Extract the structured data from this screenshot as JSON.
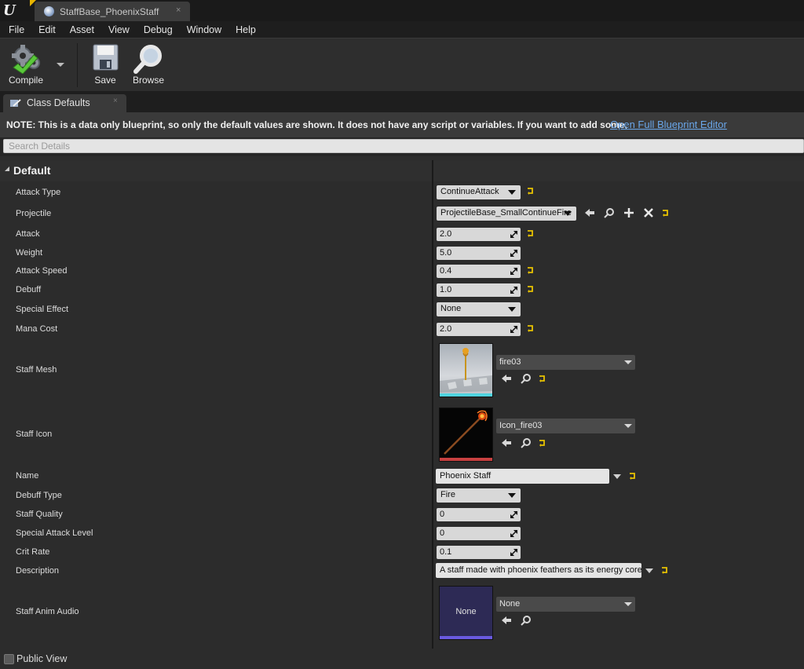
{
  "window": {
    "logo": "U",
    "doc_tab_title": "StaffBase_PhoenixStaff",
    "doc_tab_close": "×"
  },
  "menu": [
    "File",
    "Edit",
    "Asset",
    "View",
    "Debug",
    "Window",
    "Help"
  ],
  "toolbar": {
    "compile_label": "Compile",
    "save_label": "Save",
    "browse_label": "Browse"
  },
  "panel": {
    "tab_label": "Class Defaults",
    "tab_close": "×",
    "note": "NOTE: This is a data only blueprint, so only the default values are shown.  It does not have any script or variables.  If you want to add some,",
    "note_link": "Open Full Blueprint Editor",
    "search_placeholder": "Search Details",
    "category": "Default"
  },
  "properties": {
    "attack_type": {
      "label": "Attack Type",
      "value": "ContinueAttack"
    },
    "projectile": {
      "label": "Projectile",
      "value": "ProjectileBase_SmallContinueFire"
    },
    "attack": {
      "label": "Attack",
      "value": "2.0"
    },
    "weight": {
      "label": "Weight",
      "value": "5.0"
    },
    "attack_speed": {
      "label": "Attack Speed",
      "value": "0.4"
    },
    "debuff": {
      "label": "Debuff",
      "value": "1.0"
    },
    "special_effect": {
      "label": "Special Effect",
      "value": "None"
    },
    "mana_cost": {
      "label": "Mana Cost",
      "value": "2.0"
    },
    "staff_mesh": {
      "label": "Staff Mesh",
      "value": "fire03"
    },
    "staff_icon": {
      "label": "Staff Icon",
      "value": "Icon_fire03"
    },
    "name": {
      "label": "Name",
      "value": "Phoenix Staff"
    },
    "debuff_type": {
      "label": "Debuff Type",
      "value": "Fire"
    },
    "staff_quality": {
      "label": "Staff Quality",
      "value": "0"
    },
    "special_attack_level": {
      "label": "Special Attack Level",
      "value": "0"
    },
    "crit_rate": {
      "label": "Crit Rate",
      "value": "0.1"
    },
    "description": {
      "label": "Description",
      "value": "A staff made with phoenix feathers as its energy core"
    },
    "staff_anim_audio": {
      "label": "Staff Anim Audio",
      "value": "None",
      "thumb_text": "None"
    }
  },
  "footer": {
    "public_view": "Public View"
  },
  "colors": {
    "accent_link": "#6aa7ea",
    "reset_arrow": "#e8c200",
    "mesh_underline": "#4fd4e0",
    "texture_underline": "#c84040",
    "audio_underline": "#6a5ae0"
  }
}
